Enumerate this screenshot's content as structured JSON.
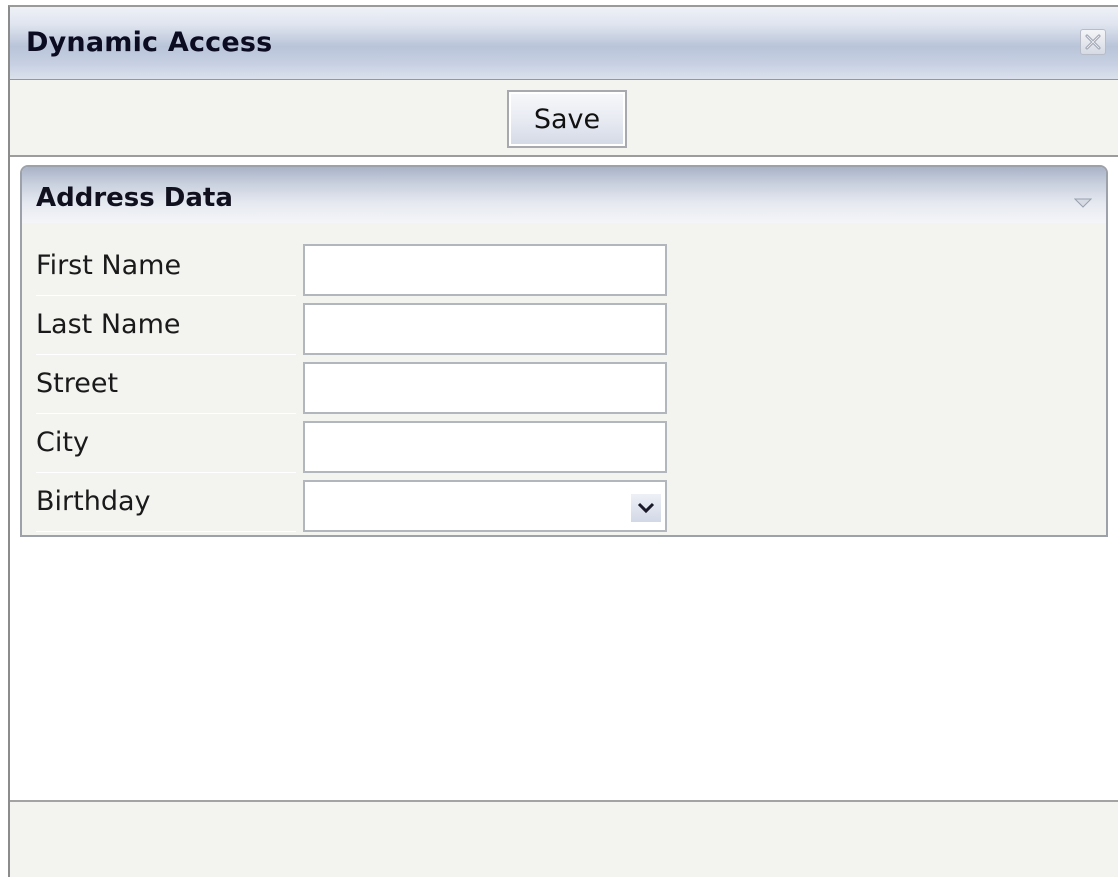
{
  "window": {
    "title": "Dynamic Access",
    "close_icon": "close-icon"
  },
  "toolbar": {
    "save_label": "Save"
  },
  "panel": {
    "title": "Address Data",
    "collapse_icon": "collapse-triangle-icon",
    "fields": [
      {
        "label": "First Name",
        "value": ""
      },
      {
        "label": "Last Name",
        "value": ""
      },
      {
        "label": "Street",
        "value": ""
      },
      {
        "label": "City",
        "value": ""
      },
      {
        "label": "Birthday",
        "value": "",
        "dropdown_icon": "chevron-down-icon"
      }
    ]
  },
  "colors": {
    "title_bar": "#b9c4d9",
    "panel_background": "#f3f4f0",
    "text": "#0b0b22"
  }
}
